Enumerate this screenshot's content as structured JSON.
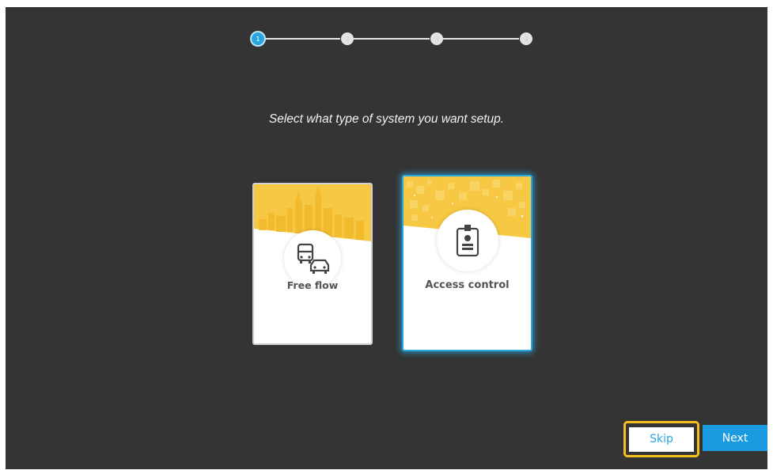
{
  "stepper": {
    "steps": [
      {
        "label": "1",
        "state": "active"
      },
      {
        "label": "2",
        "state": "inactive"
      },
      {
        "label": "3",
        "state": "inactive"
      },
      {
        "label": "4",
        "state": "inactive"
      }
    ]
  },
  "instruction": "Select what type of system you want setup.",
  "options": [
    {
      "label": "Free flow",
      "icon": "bus-car-icon",
      "selected": false
    },
    {
      "label": "Access control",
      "icon": "id-badge-icon",
      "selected": true
    }
  ],
  "buttons": {
    "skip_label": "Skip",
    "next_label": "Next"
  },
  "colors": {
    "background": "#343434",
    "accent": "#29a6e0",
    "banner": "#f7c843",
    "focus_ring": "#f5bf1f"
  }
}
